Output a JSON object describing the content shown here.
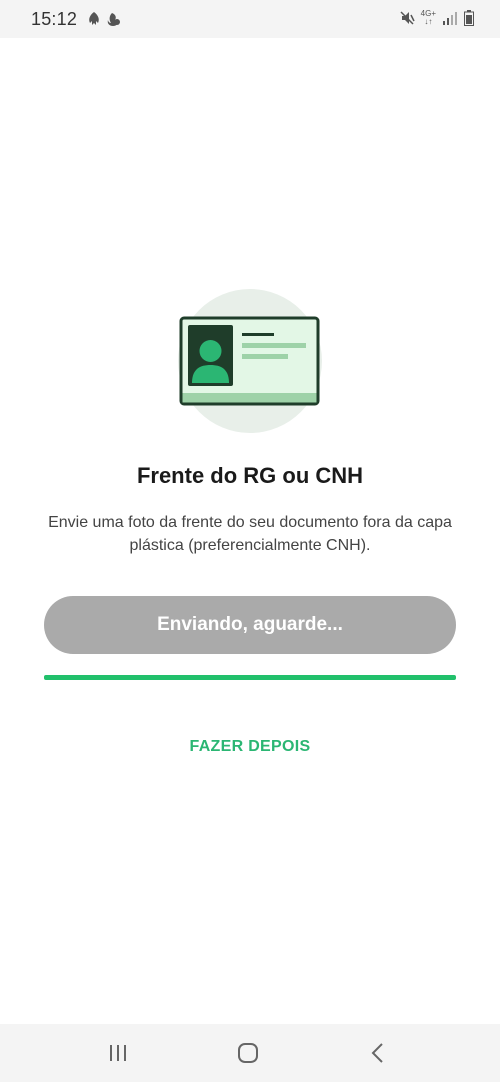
{
  "status_bar": {
    "time": "15:12",
    "network_label_top": "4G+",
    "network_label_bottom": "↓↑"
  },
  "document_step": {
    "title": "Frente do RG ou CNH",
    "description": "Envie uma foto da frente do seu documento fora da capa plástica (preferencialmente CNH).",
    "upload_button_label": "Enviando, aguarde...",
    "upload_progress": 1.0,
    "later_link_label": "FAZER DEPOIS"
  },
  "colors": {
    "accent": "#2bb673",
    "progress": "#21c06b",
    "button_disabled": "#aaaaaa",
    "card_border": "#1f3d2a"
  },
  "icons": {
    "illustration": "id-card-icon",
    "nav_recent": "recent-apps-icon",
    "nav_home": "home-icon",
    "nav_back": "back-icon"
  }
}
